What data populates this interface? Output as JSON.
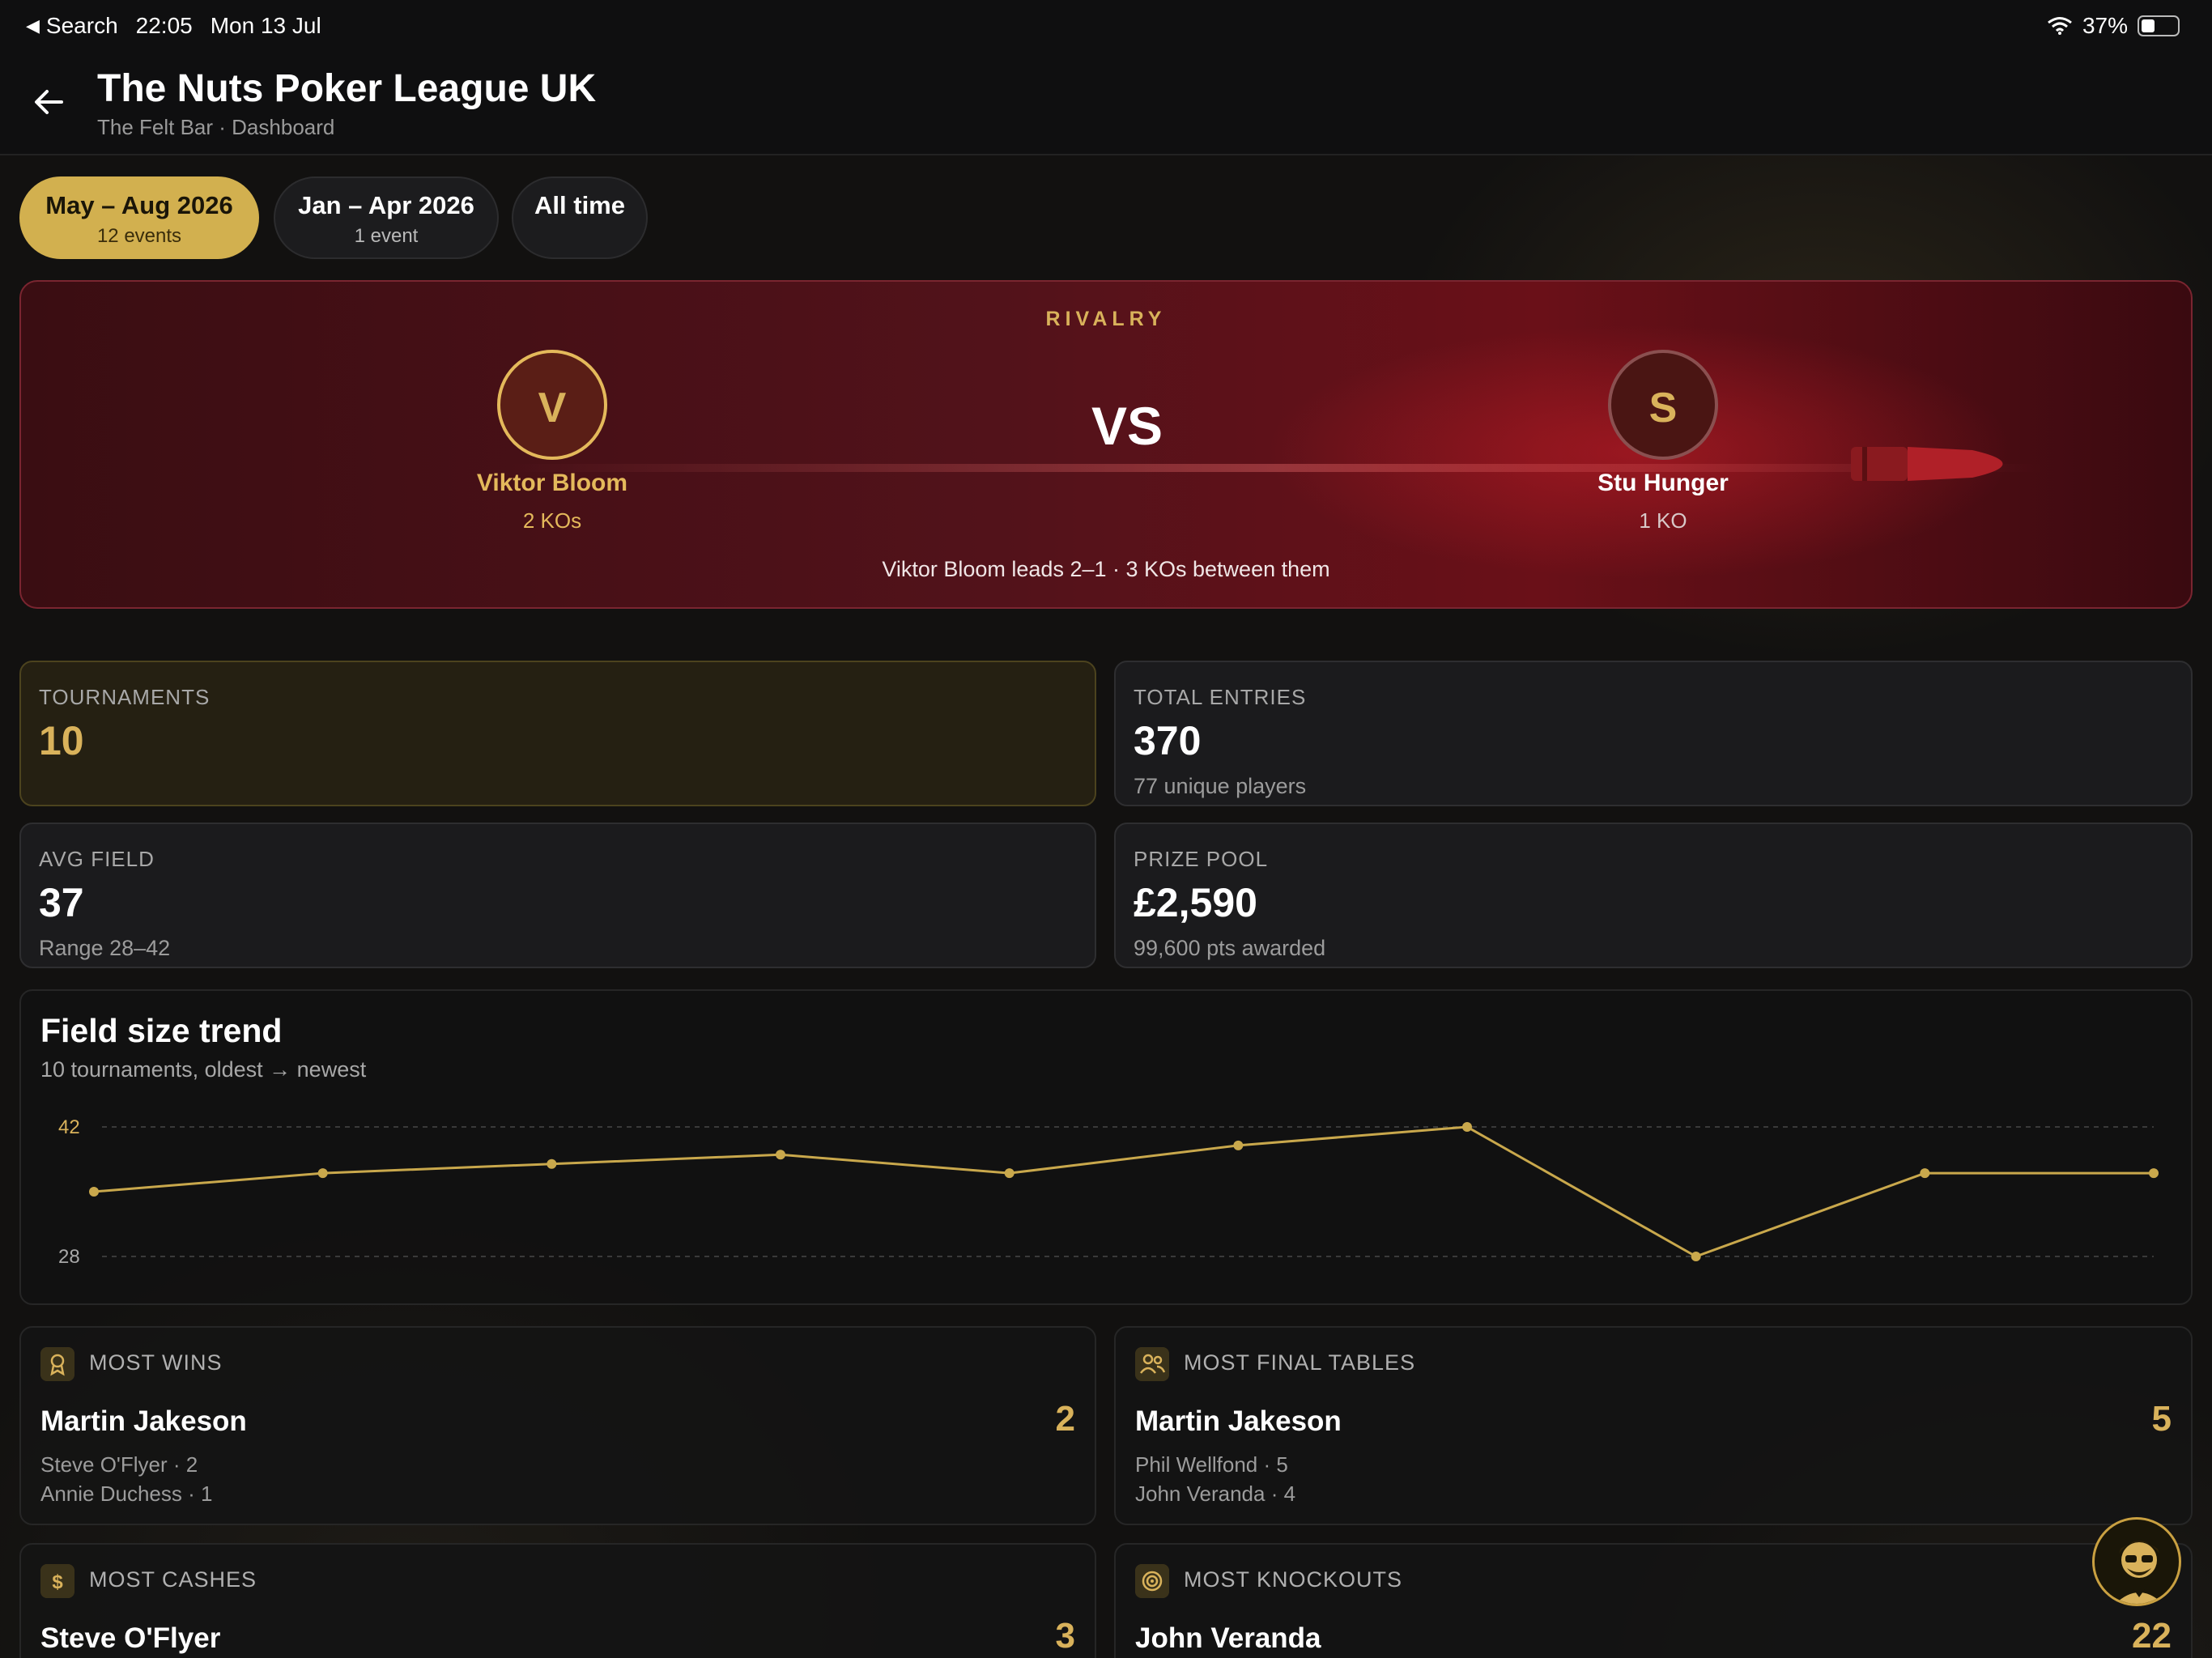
{
  "status_bar": {
    "back_label": "Search",
    "time": "22:05",
    "date": "Mon 13 Jul",
    "battery": "37%",
    "battery_level": 0.37
  },
  "header": {
    "title": "The Nuts Poker League UK",
    "subtitle": "The Felt Bar · Dashboard"
  },
  "filters": [
    {
      "label": "May – Aug 2026",
      "sub": "12 events",
      "active": true
    },
    {
      "label": "Jan – Apr 2026",
      "sub": "1 event",
      "active": false
    },
    {
      "label": "All time",
      "sub": "",
      "active": false
    }
  ],
  "rivalry": {
    "label": "RIVALRY",
    "vs": "VS",
    "player_a": {
      "initial": "V",
      "name": "Viktor Bloom",
      "kos": "2 KOs"
    },
    "player_b": {
      "initial": "S",
      "name": "Stu Hunger",
      "kos": "1 KO"
    },
    "summary": "Viktor Bloom leads 2–1 · 3 KOs between them"
  },
  "stats": {
    "tournaments": {
      "label": "TOURNAMENTS",
      "value": "10"
    },
    "total_entries": {
      "label": "TOTAL ENTRIES",
      "value": "370",
      "sub": "77 unique players"
    },
    "avg_field": {
      "label": "AVG FIELD",
      "value": "37",
      "sub": "Range 28–42"
    },
    "prize_pool": {
      "label": "PRIZE POOL",
      "value": "£2,590",
      "sub": "99,600 pts awarded"
    }
  },
  "chart_data": {
    "type": "line",
    "title": "Field size trend",
    "subtitle": "10 tournaments, oldest → newest",
    "yticks": [
      "42",
      "28"
    ],
    "ylim": [
      28,
      42
    ],
    "x": [
      1,
      2,
      3,
      4,
      5,
      6,
      7,
      8,
      9,
      10
    ],
    "values": [
      35,
      37,
      38,
      39,
      37,
      40,
      42,
      28,
      37,
      37
    ],
    "line_color": "#c9a84c",
    "grid": true
  },
  "leaders": {
    "most_wins": {
      "title": "MOST WINS",
      "name": "Martin Jakeson",
      "value": "2",
      "runner1": "Steve O'Flyer · 2",
      "runner2": "Annie Duchess · 1",
      "icon": "award-icon"
    },
    "most_final_tables": {
      "title": "MOST FINAL TABLES",
      "name": "Martin Jakeson",
      "value": "5",
      "runner1": "Phil Wellfond · 5",
      "runner2": "John Veranda · 4",
      "icon": "users-icon"
    },
    "most_cashes": {
      "title": "MOST CASHES",
      "name": "Steve O'Flyer",
      "value": "3",
      "icon": "dollar-icon"
    },
    "most_knockouts": {
      "title": "MOST KNOCKOUTS",
      "name": "John Veranda",
      "value": "22",
      "icon": "target-icon"
    }
  },
  "colors": {
    "accent": "#d2b04f",
    "background": "#0f0f10",
    "rivalry": "#52121a"
  }
}
